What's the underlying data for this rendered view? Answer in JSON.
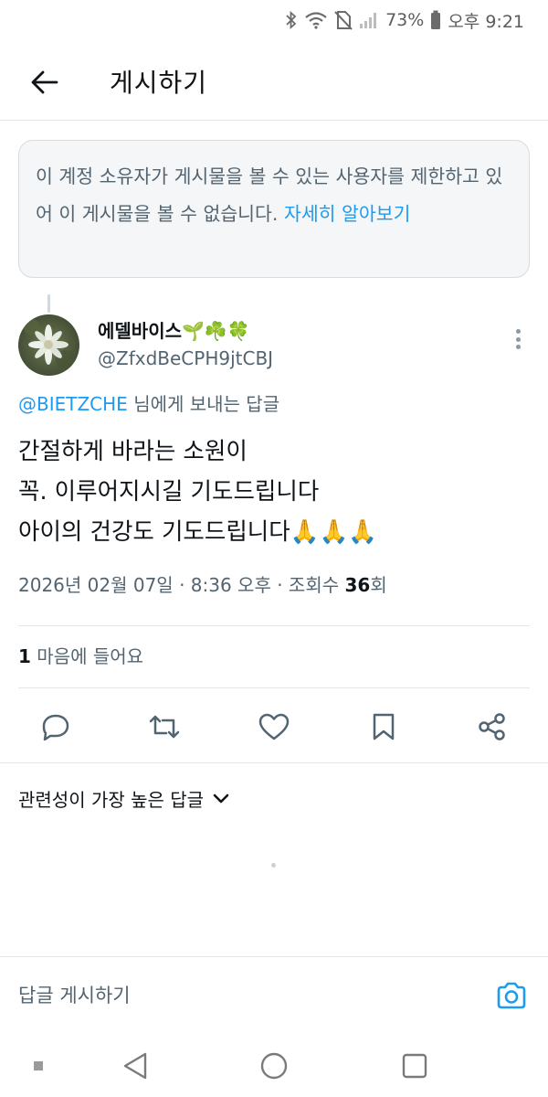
{
  "status_bar": {
    "battery": "73%",
    "time": "오후 9:21"
  },
  "header": {
    "title": "게시하기"
  },
  "notice": {
    "text": "이 계정 소유자가 게시물을 볼 수 있는 사용자를 제한하고 있어 이 게시물을 볼 수 없습니다.",
    "link": "자세히 알아보기"
  },
  "post": {
    "author_name": "에델바이스",
    "author_emoji": "🌱☘️🍀",
    "author_handle": "@ZfxdBeCPH9jtCBJ",
    "reply_mention": "@BIETZCHE",
    "reply_suffix": "님에게 보내는 답글",
    "lines": [
      "간절하게 바라는 소원이",
      "꼭. 이루어지시길 기도드립니다",
      "아이의 건강도 기도드립니다🙏🙏🙏"
    ],
    "meta_prefix": "2026년 02월 07일 · 8:36 오후 · 조회수 ",
    "views": "36",
    "views_suffix": "회",
    "likes_count": "1",
    "likes_label": "마음에 들어요"
  },
  "sort": {
    "label": "관련성이 가장 높은 답글"
  },
  "compose": {
    "placeholder": "답글 게시하기"
  },
  "icons": {
    "back": "arrow-left-icon",
    "reply": "reply-icon",
    "repost": "repost-icon",
    "like": "heart-icon",
    "bookmark": "bookmark-icon",
    "share": "share-icon",
    "camera": "camera-icon"
  },
  "colors": {
    "accent": "#1d9bf0",
    "secondary_text": "#536471",
    "notice_bg": "#f4f6f8"
  }
}
